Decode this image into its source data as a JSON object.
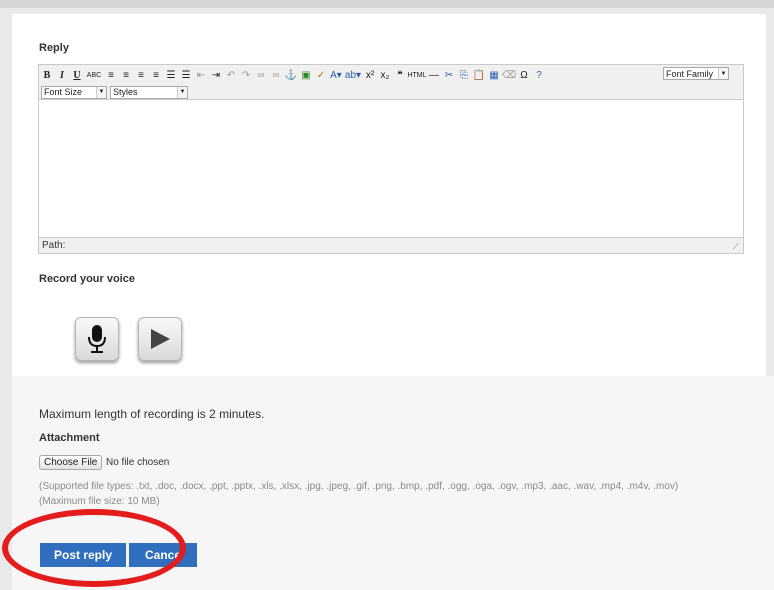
{
  "reply_label": "Reply",
  "editor": {
    "toolbar_row1": [
      {
        "name": "bold-button",
        "glyph": "B",
        "cls": "b"
      },
      {
        "name": "italic-button",
        "glyph": "I",
        "cls": "i"
      },
      {
        "name": "underline-button",
        "glyph": "U",
        "cls": "u"
      },
      {
        "name": "strikethrough-button",
        "glyph": "ABC",
        "cls": "small"
      },
      {
        "name": "align-left-button",
        "glyph": "≡",
        "cls": ""
      },
      {
        "name": "align-center-button",
        "glyph": "≡",
        "cls": ""
      },
      {
        "name": "align-right-button",
        "glyph": "≡",
        "cls": ""
      },
      {
        "name": "align-justify-button",
        "glyph": "≡",
        "cls": ""
      },
      {
        "name": "bullet-list-button",
        "glyph": "☰",
        "cls": ""
      },
      {
        "name": "numbered-list-button",
        "glyph": "☰",
        "cls": ""
      },
      {
        "name": "outdent-button",
        "glyph": "⇤",
        "cls": "grey"
      },
      {
        "name": "indent-button",
        "glyph": "⇥",
        "cls": ""
      },
      {
        "name": "undo-button",
        "glyph": "↶",
        "cls": "grey"
      },
      {
        "name": "redo-button",
        "glyph": "↷",
        "cls": "grey"
      },
      {
        "name": "link-button",
        "glyph": "∞",
        "cls": "grey"
      },
      {
        "name": "unlink-button",
        "glyph": "∞",
        "cls": "grey"
      },
      {
        "name": "anchor-button",
        "glyph": "⚓",
        "cls": "blue"
      },
      {
        "name": "image-button",
        "glyph": "▣",
        "cls": "green"
      },
      {
        "name": "cleanup-button",
        "glyph": "✓",
        "cls": "orange"
      },
      {
        "name": "text-color-button",
        "glyph": "A▾",
        "cls": "blue"
      },
      {
        "name": "background-color-button",
        "glyph": "ab▾",
        "cls": "blue"
      },
      {
        "name": "superscript-button",
        "glyph": "x²",
        "cls": ""
      },
      {
        "name": "subscript-button",
        "glyph": "x₂",
        "cls": ""
      },
      {
        "name": "blockquote-button",
        "glyph": "❝",
        "cls": ""
      },
      {
        "name": "html-button",
        "glyph": "HTML",
        "cls": "small"
      },
      {
        "name": "horizontal-rule-button",
        "glyph": "—",
        "cls": ""
      },
      {
        "name": "cut-button",
        "glyph": "✂",
        "cls": "blue"
      },
      {
        "name": "copy-button",
        "glyph": "⎘",
        "cls": "blue"
      },
      {
        "name": "paste-button",
        "glyph": "📋",
        "cls": ""
      },
      {
        "name": "table-button",
        "glyph": "▦",
        "cls": "blue"
      },
      {
        "name": "eraser-button",
        "glyph": "⌫",
        "cls": "grey"
      },
      {
        "name": "special-char-button",
        "glyph": "Ω",
        "cls": ""
      },
      {
        "name": "help-button",
        "glyph": "?",
        "cls": "blue"
      }
    ],
    "font_family": "Font Family",
    "font_size": "Font Size",
    "styles": "Styles",
    "path_label": "Path:"
  },
  "record_label": "Record your voice",
  "max_length_text": "Maximum length of recording is 2 minutes.",
  "attachment_label": "Attachment",
  "choose_file_label": "Choose File",
  "no_file_text": "No file chosen",
  "supported_types": "(Supported file types: .txt, .doc, .docx, .ppt, .pptx, .xls, .xlsx, .jpg, .jpeg, .gif, .png, .bmp, .pdf, .ogg, .oga, .ogv, .mp3, .aac, .wav, .mp4, .m4v, .mov)",
  "max_file_size": "(Maximum file size: 10 MB)",
  "post_reply_label": "Post reply",
  "cancel_label": "Cance",
  "colors": {
    "primary": "#2f6fbd",
    "highlight": "#e41c1c"
  }
}
